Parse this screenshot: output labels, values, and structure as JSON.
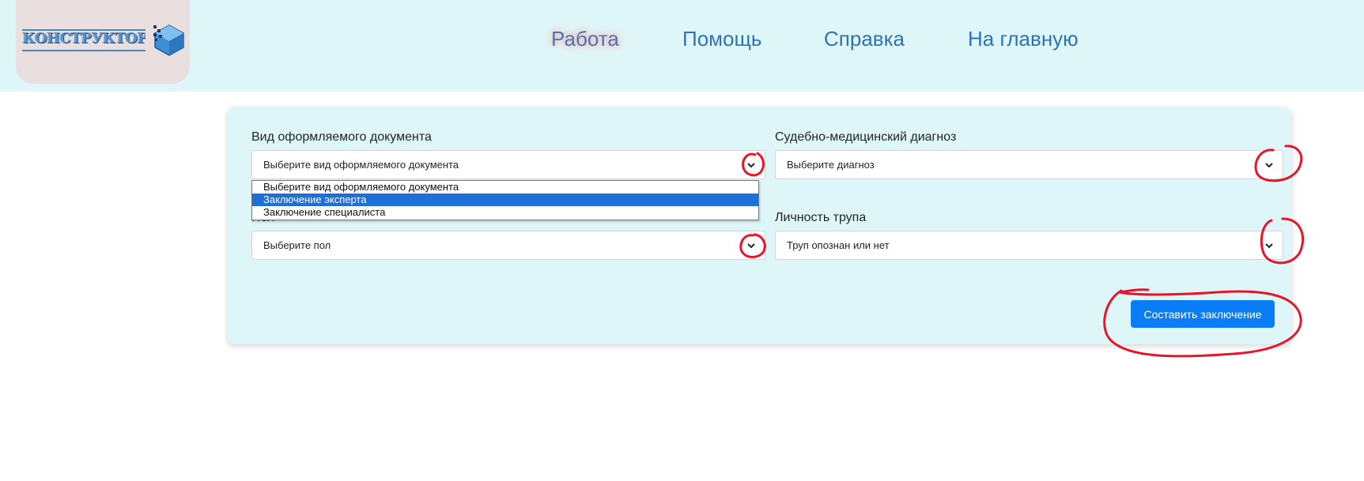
{
  "nav": {
    "items": [
      {
        "label": "Работа",
        "active": true
      },
      {
        "label": "Помощь"
      },
      {
        "label": "Справка"
      },
      {
        "label": "На главную"
      }
    ]
  },
  "form": {
    "doc_type": {
      "label": "Вид оформляемого документа",
      "value": "Выберите вид оформляемого документа",
      "options": [
        "Выберите вид оформляемого документа",
        "Заключение эксперта",
        "Заключение специалиста"
      ],
      "highlighted_option": "Заключение эксперта"
    },
    "diagnosis": {
      "label": "Судебно-медицинский диагноз",
      "value": "Выберите диагноз"
    },
    "sex": {
      "label": "Пол",
      "value": "Выберите пол"
    },
    "identity": {
      "label": "Личность трупа",
      "value": "Труп опознан или нет"
    },
    "submit_label": "Составить заключение"
  },
  "colors": {
    "header_bg": "#dff6f8",
    "panel_bg": "#dff6f8",
    "nav_link": "#2d74b5",
    "primary_button": "#0a7cf5",
    "option_highlight": "#1e6fd9",
    "annotation_marker": "#e8142a"
  }
}
